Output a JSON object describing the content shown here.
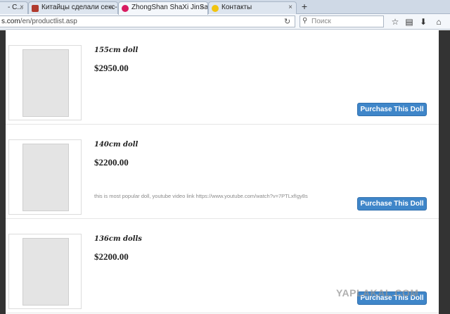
{
  "browser": {
    "tabs": [
      {
        "label": "- С...",
        "favicon_color": "#c0392b"
      },
      {
        "label": "Китайцы сделали секс-ку...",
        "favicon_color": "#b03a2e"
      },
      {
        "label": "ZhongShan ShaXi JinSan Cl...",
        "favicon_color": "#d81b60"
      },
      {
        "label": "Контакты",
        "favicon_color": "#f1c40f"
      }
    ],
    "new_tab_label": "+",
    "url_host": "s.com",
    "url_path": "/en/productlist.asp",
    "search_placeholder": "Поиск",
    "icons": {
      "reload": "reload-icon",
      "search": "search-icon",
      "bookmark": "star-icon",
      "reading_list": "clipboard-icon",
      "download": "download-icon",
      "home": "home-icon"
    }
  },
  "products": [
    {
      "name": "155cm doll",
      "price": "$2950.00",
      "description": "",
      "button": "Purchase This Doll"
    },
    {
      "name": "140cm doll",
      "price": "$2200.00",
      "description": "this is most popular doll, youtube video link https://www.youtube.com/watch?v=7PTLxfIgy8s",
      "button": "Purchase This Doll"
    },
    {
      "name": "136cm dolls",
      "price": "$2200.00",
      "description": "",
      "button": "Purchase This Doll"
    }
  ],
  "watermark": "YAPLAKAL.COM",
  "colors": {
    "button": "#3f86c9",
    "page_frame": "#333333",
    "tab_strip": "#cfd9e6"
  }
}
